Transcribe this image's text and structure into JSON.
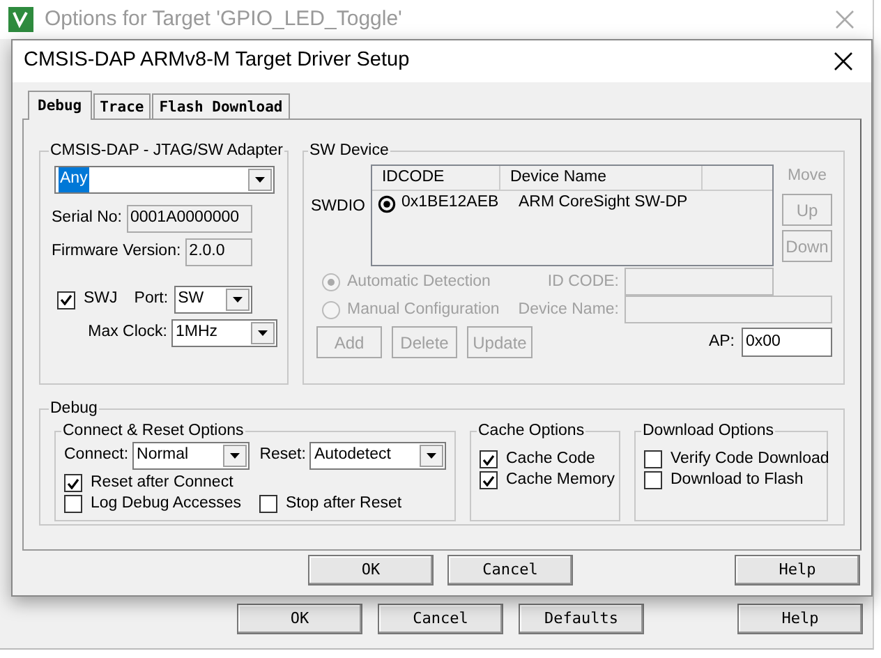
{
  "background_window": {
    "title": "Options for Target 'GPIO_LED_Toggle'",
    "buttons": [
      {
        "label": "OK"
      },
      {
        "label": "Cancel"
      },
      {
        "label": "Defaults"
      },
      {
        "label": "Help"
      }
    ]
  },
  "dialog": {
    "title": "CMSIS-DAP ARMv8-M Target Driver Setup",
    "tabs": [
      {
        "label": "Debug",
        "selected": true
      },
      {
        "label": "Trace",
        "selected": false
      },
      {
        "label": "Flash Download",
        "selected": false
      }
    ],
    "adapter": {
      "legend": "CMSIS-DAP - JTAG/SW Adapter",
      "device": "Any",
      "device_focused": true,
      "serial_label": "Serial No:",
      "serial": "0001A0000000",
      "firmware_label": "Firmware Version:",
      "firmware": "2.0.0",
      "swj": {
        "label": "SWJ",
        "checked": true
      },
      "port_label": "Port:",
      "port": "SW",
      "clock_label": "Max Clock:",
      "clock": "1MHz"
    },
    "sw_device": {
      "legend": "SW Device",
      "row_label": "SWDIO",
      "columns": [
        "IDCODE",
        "Device Name"
      ],
      "rows": [
        {
          "idcode": "0x1BE12AEB",
          "name": "ARM CoreSight SW-DP",
          "selected": true
        }
      ],
      "move_label": "Move",
      "move_buttons": [
        {
          "label": "Up",
          "disabled": true
        },
        {
          "label": "Down",
          "disabled": true
        }
      ],
      "detection": [
        {
          "label": "Automatic Detection",
          "selected": true,
          "disabled": true
        },
        {
          "label": "Manual Configuration",
          "selected": false,
          "disabled": true
        }
      ],
      "id_code_label": "ID CODE:",
      "device_name_label": "Device Name:",
      "actions": [
        {
          "label": "Add",
          "disabled": true
        },
        {
          "label": "Delete",
          "disabled": true
        },
        {
          "label": "Update",
          "disabled": true
        }
      ],
      "ap_label": "AP:",
      "ap": "0x00"
    },
    "debug": {
      "legend": "Debug",
      "connect_reset": {
        "legend": "Connect & Reset Options",
        "connect_label": "Connect:",
        "connect": "Normal",
        "reset_label": "Reset:",
        "reset": "Autodetect",
        "options": [
          {
            "label": "Reset after Connect",
            "checked": true
          },
          {
            "label": "Log Debug Accesses",
            "checked": false
          },
          {
            "label": "Stop after Reset",
            "checked": false
          }
        ]
      },
      "cache": {
        "legend": "Cache Options",
        "options": [
          {
            "label": "Cache Code",
            "checked": true
          },
          {
            "label": "Cache Memory",
            "checked": true
          }
        ]
      },
      "download": {
        "legend": "Download Options",
        "options": [
          {
            "label": "Verify Code Download",
            "checked": false
          },
          {
            "label": "Download to Flash",
            "checked": false
          }
        ]
      }
    },
    "buttons": [
      {
        "label": "OK"
      },
      {
        "label": "Cancel"
      },
      {
        "label": "Help"
      }
    ]
  }
}
